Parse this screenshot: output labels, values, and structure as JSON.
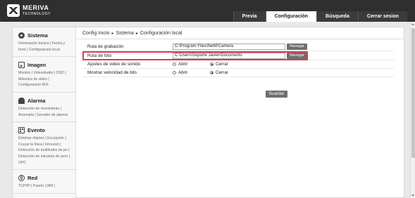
{
  "header": {
    "brand_name": "MERIVA",
    "brand_sub": "TECHNOLOGY",
    "tabs": [
      {
        "label": "Previa",
        "active": false
      },
      {
        "label": "Configuración",
        "active": true
      },
      {
        "label": "Búsqueda",
        "active": false
      },
      {
        "label": "Cerrar sesion",
        "active": false
      }
    ]
  },
  "sidebar": {
    "sections": [
      {
        "title": "Sistema",
        "icon": "gear-icon",
        "links": "Información básica | Fecha y hora | Configuración local"
      },
      {
        "title": "Imagen",
        "icon": "image-icon",
        "links": "Monitor | Video/Audio | OSD | Máscara de video | Configuración ROI"
      },
      {
        "title": "Alarma",
        "icon": "bell-icon",
        "links": "Detección de movimiento | Anomalía | Servidor de alarma"
      },
      {
        "title": "Evento",
        "icon": "event-icon",
        "links": "Eliminar objetos | Excepción | Cruzar la línea | Intrusion | Detección de multitudes de pe | Detección de intrusión de pero | CPC"
      },
      {
        "title": "Red",
        "icon": "globe-icon",
        "links": "TCP/IP | Puerto | Wifi |"
      }
    ]
  },
  "breadcrumb": {
    "items": [
      "Config Inicio",
      "Sistema",
      "Configuración local"
    ],
    "separator": "▸"
  },
  "form": {
    "record_path_label": "Ruta de grabación",
    "record_path_value": "C:\\Program Files\\NetIPCamera",
    "photo_path_label": "Ruta de foto",
    "photo_path_value": "C:\\Users\\Soporte Javier\\Documents",
    "browse_label": "Navegar",
    "video_sound_label": "Ajustes de video de sonido",
    "bitrate_label": "Mostrar velocidad de bits",
    "open_label": "Abrir",
    "close_label": "Cerrar",
    "video_sound_selected": "Cerrar",
    "bitrate_selected": "Cerrar",
    "save_label": "Guardar"
  },
  "colors": {
    "header_bg": "#2f2f2f",
    "highlight": "#e0394d",
    "button_bg": "#6e6e6e"
  }
}
